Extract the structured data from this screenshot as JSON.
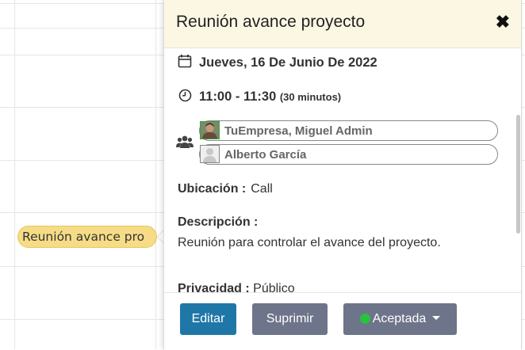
{
  "calendar": {
    "event_chip_label": "Reunión avance pro"
  },
  "popover": {
    "title": "Reunión avance proyecto",
    "close_icon": "close-icon",
    "date": "Jueves, 16 De Junio De 2022",
    "time_range": "11:00 - 11:30",
    "duration": "(30 minutos)",
    "attendees": [
      {
        "name": "TuEmpresa, Miguel Admin",
        "avatar": "photo-avatar"
      },
      {
        "name": "Alberto García",
        "avatar": "default-user-avatar"
      }
    ],
    "location_label": "Ubicación :",
    "location_value": "Call",
    "description_label": "Descripción :",
    "description_value": "Reunión para controlar el avance del proyecto.",
    "privacy_label": "Privacidad :",
    "privacy_value": "Público"
  },
  "footer": {
    "edit_label": "Editar",
    "delete_label": "Suprimir",
    "status_label": "Aceptada",
    "status_color": "#27c23e"
  },
  "colors": {
    "header_bg": "#fcf7e3",
    "edit_button": "#1f77a8",
    "secondary_button": "#6e7489",
    "event_chip": "#f6dc86"
  }
}
